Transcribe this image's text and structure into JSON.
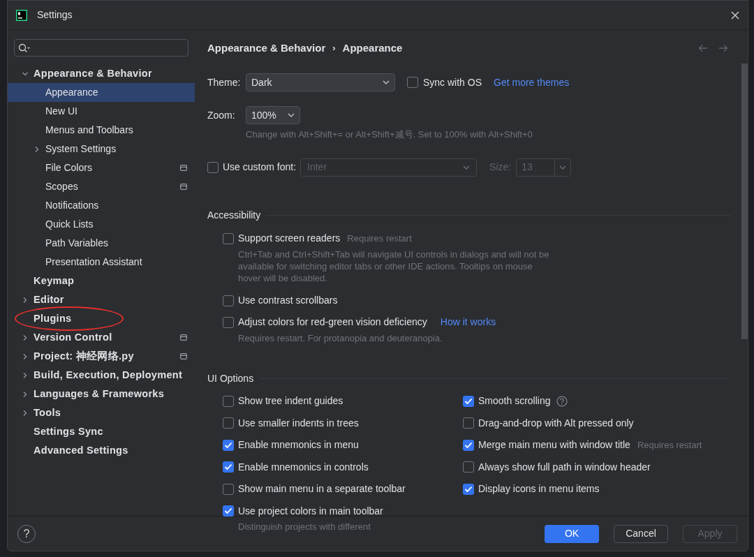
{
  "window": {
    "title": "Settings"
  },
  "sidebar": {
    "items": [
      {
        "label": "Appearance & Behavior",
        "expanded": true,
        "selected": false,
        "project_level": false,
        "circled": false,
        "children": [
          {
            "label": "Appearance",
            "selected": true,
            "project_level": false,
            "circled": false
          },
          {
            "label": "New UI",
            "selected": false,
            "project_level": false,
            "circled": false
          },
          {
            "label": "Menus and Toolbars",
            "selected": false,
            "project_level": false,
            "circled": false
          },
          {
            "label": "System Settings",
            "expanded": false,
            "selected": false,
            "project_level": false,
            "circled": false
          },
          {
            "label": "File Colors",
            "selected": false,
            "project_level": true,
            "circled": false
          },
          {
            "label": "Scopes",
            "selected": false,
            "project_level": true,
            "circled": false
          },
          {
            "label": "Notifications",
            "selected": false,
            "project_level": false,
            "circled": false
          },
          {
            "label": "Quick Lists",
            "selected": false,
            "project_level": false,
            "circled": false
          },
          {
            "label": "Path Variables",
            "selected": false,
            "project_level": false,
            "circled": false
          },
          {
            "label": "Presentation Assistant",
            "selected": false,
            "project_level": false,
            "circled": false
          }
        ]
      },
      {
        "label": "Keymap",
        "selected": false,
        "project_level": false,
        "circled": false
      },
      {
        "label": "Editor",
        "expanded": false,
        "selected": false,
        "project_level": false,
        "circled": false
      },
      {
        "label": "Plugins",
        "selected": false,
        "project_level": false,
        "circled": true
      },
      {
        "label": "Version Control",
        "expanded": false,
        "selected": false,
        "project_level": true,
        "circled": false
      },
      {
        "label": "Project: 神经网络.py",
        "expanded": false,
        "selected": false,
        "project_level": true,
        "circled": false
      },
      {
        "label": "Build, Execution, Deployment",
        "expanded": false,
        "selected": false,
        "project_level": false,
        "circled": false
      },
      {
        "label": "Languages & Frameworks",
        "expanded": false,
        "selected": false,
        "project_level": false,
        "circled": false
      },
      {
        "label": "Tools",
        "expanded": false,
        "selected": false,
        "project_level": false,
        "circled": false
      },
      {
        "label": "Settings Sync",
        "selected": false,
        "project_level": false,
        "circled": false
      },
      {
        "label": "Advanced Settings",
        "selected": false,
        "project_level": false,
        "circled": false
      }
    ]
  },
  "breadcrumb": [
    "Appearance & Behavior",
    "Appearance"
  ],
  "breadcrumb_separator": "›",
  "theme": {
    "label": "Theme:",
    "value": "Dark"
  },
  "sync_with_os": {
    "label": "Sync with OS",
    "checked": false
  },
  "more_themes_link": "Get more themes",
  "zoom": {
    "label": "Zoom:",
    "value": "100%",
    "hint": "Change with Alt+Shift+= or Alt+Shift+减号. Set to 100% with Alt+Shift+0"
  },
  "custom_font": {
    "label": "Use custom font:",
    "checked": false,
    "font": "Inter",
    "size_label": "Size:",
    "size": "13"
  },
  "accessibility": {
    "title": "Accessibility",
    "options": [
      {
        "label": "Support screen readers",
        "checked": false,
        "note": "Requires restart",
        "description": "Ctrl+Tab and Ctrl+Shift+Tab will navigate UI controls in dialogs and will not be available for switching editor tabs or other IDE actions. Tooltips on mouse hover will be disabled."
      },
      {
        "label": "Use contrast scrollbars",
        "checked": false
      },
      {
        "label": "Adjust colors for red-green vision deficiency",
        "checked": false,
        "link": "How it works",
        "description": "Requires restart. For protanopia and deuteranopia."
      }
    ]
  },
  "ui_options": {
    "title": "UI Options",
    "left": [
      {
        "label": "Show tree indent guides",
        "checked": false
      },
      {
        "label": "Use smaller indents in trees",
        "checked": false
      },
      {
        "label": "Enable mnemonics in menu",
        "checked": true
      },
      {
        "label": "Enable mnemonics in controls",
        "checked": true
      },
      {
        "label": "Show main menu in a separate toolbar",
        "checked": false
      },
      {
        "label": "Use project colors in main toolbar",
        "checked": true,
        "description": "Distinguish projects with different"
      }
    ],
    "right": [
      {
        "label": "Smooth scrolling",
        "checked": true,
        "help": true
      },
      {
        "label": "Drag-and-drop with Alt pressed only",
        "checked": false
      },
      {
        "label": "Merge main menu with window title",
        "checked": true,
        "note": "Requires restart"
      },
      {
        "label": "Always show full path in window header",
        "checked": false
      },
      {
        "label": "Display icons in menu items",
        "checked": true
      }
    ]
  },
  "help_button": "?",
  "buttons": [
    {
      "label": "OK",
      "kind": "primary"
    },
    {
      "label": "Cancel",
      "kind": "default"
    },
    {
      "label": "Apply",
      "kind": "disabled"
    }
  ]
}
